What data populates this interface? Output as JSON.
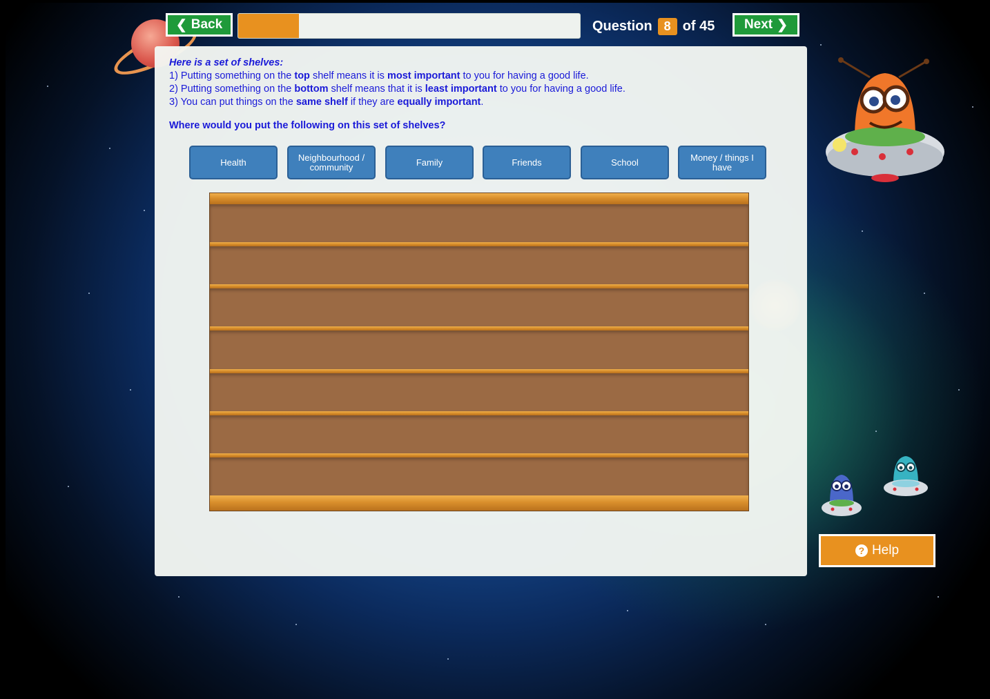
{
  "topbar": {
    "back_label": "Back",
    "next_label": "Next",
    "question_label": "Question",
    "question_number": "8",
    "question_total": "of 45",
    "progress": 0.178
  },
  "instructions": {
    "heading": "Here is a set of shelves:",
    "line1": {
      "pre": "1) Putting something on the ",
      "b1": "top",
      "mid": " shelf means it is ",
      "b2": "most important",
      "post": " to you for having a good life."
    },
    "line2": {
      "pre": "2) Putting something on the ",
      "b1": "bottom",
      "mid": " shelf means that it is ",
      "b2": "least important",
      "post": " to you for having a good life."
    },
    "line3": {
      "pre": "3) You can put things on the ",
      "b1": "same shelf",
      "mid": " if they are ",
      "b2": "equally important",
      "post": "."
    }
  },
  "question_text": "Where would you put the following on this set of shelves?",
  "items": [
    {
      "label": "Health"
    },
    {
      "label": "Neighbourhood / community"
    },
    {
      "label": "Family"
    },
    {
      "label": "Friends"
    },
    {
      "label": "School"
    },
    {
      "label": "Money / things I have"
    }
  ],
  "shelves": {
    "count": 7
  },
  "help": {
    "label": "Help"
  },
  "colors": {
    "accent_orange": "#e8911f",
    "button_green": "#1f9a3a",
    "item_blue": "#3f80bc",
    "text_blue": "#1a1ad8",
    "shelf_brown": "#9b6a44"
  }
}
